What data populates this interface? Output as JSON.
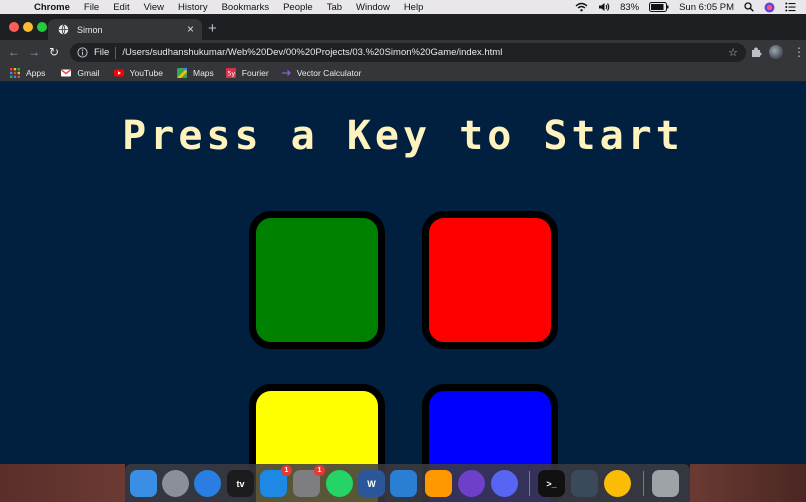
{
  "menubar": {
    "apple_glyph": "",
    "app": "Chrome",
    "items": [
      "File",
      "Edit",
      "View",
      "History",
      "Bookmarks",
      "People",
      "Tab",
      "Window",
      "Help"
    ],
    "battery": "83%",
    "clock": "Sun 6:05 PM"
  },
  "tab": {
    "title": "Simon",
    "close": "×",
    "new_tab": "+"
  },
  "toolbar": {
    "back": "←",
    "forward": "→",
    "reload": "↻",
    "scheme": "File",
    "url": "/Users/sudhanshukumar/Web%20Dev/00%20Projects/03.%20Simon%20Game/index.html",
    "star": "☆",
    "menu": "⋮"
  },
  "bookmarks": [
    {
      "label": "Apps",
      "icon": "apps-grid-icon",
      "color": "#e8710a"
    },
    {
      "label": "Gmail",
      "icon": "gmail-icon",
      "color": "#ea4335"
    },
    {
      "label": "YouTube",
      "icon": "youtube-icon",
      "color": "#ff0000"
    },
    {
      "label": "Maps",
      "icon": "maps-icon",
      "color": "#34a853"
    },
    {
      "label": "Fourier",
      "icon": "fourier-icon",
      "color": "#d9304a"
    },
    {
      "label": "Vector Calculator",
      "icon": "vector-calculator-icon",
      "color": "#8a5bd6"
    }
  ],
  "page": {
    "title": "Press a Key to Start",
    "background": "#011f3f",
    "title_color": "#fef2bf",
    "buttons": [
      {
        "name": "green",
        "color": "#008000"
      },
      {
        "name": "red",
        "color": "#ff0000"
      },
      {
        "name": "yellow",
        "color": "#ffff00"
      },
      {
        "name": "blue",
        "color": "#0000ff"
      }
    ]
  },
  "dock": {
    "apps": [
      {
        "name": "finder",
        "color": "#3a8ee6"
      },
      {
        "name": "launchpad",
        "color": "#8a8f99"
      },
      {
        "name": "safari",
        "color": "#2a7de1"
      },
      {
        "name": "apple-tv",
        "color": "#1c1c1e",
        "label": "tv"
      },
      {
        "name": "app-store",
        "color": "#1e88e5",
        "badge": "1"
      },
      {
        "name": "system-preferences",
        "color": "#7d7d82",
        "badge": "1"
      },
      {
        "name": "whatsapp",
        "color": "#25d366"
      },
      {
        "name": "word",
        "color": "#2b579a",
        "label": "W"
      },
      {
        "name": "vs-code",
        "color": "#2a7fd4"
      },
      {
        "name": "sublime-text",
        "color": "#ff9800"
      },
      {
        "name": "github-desktop",
        "color": "#6e40c9"
      },
      {
        "name": "discord",
        "color": "#5865f2"
      },
      {
        "name": "terminal",
        "color": "#111111",
        "label": ">_"
      },
      {
        "name": "quicktime",
        "color": "#3b4a5a"
      },
      {
        "name": "chrome",
        "color": "#fbbc05"
      },
      {
        "name": "trash",
        "color": "#9ea3a8"
      }
    ]
  }
}
